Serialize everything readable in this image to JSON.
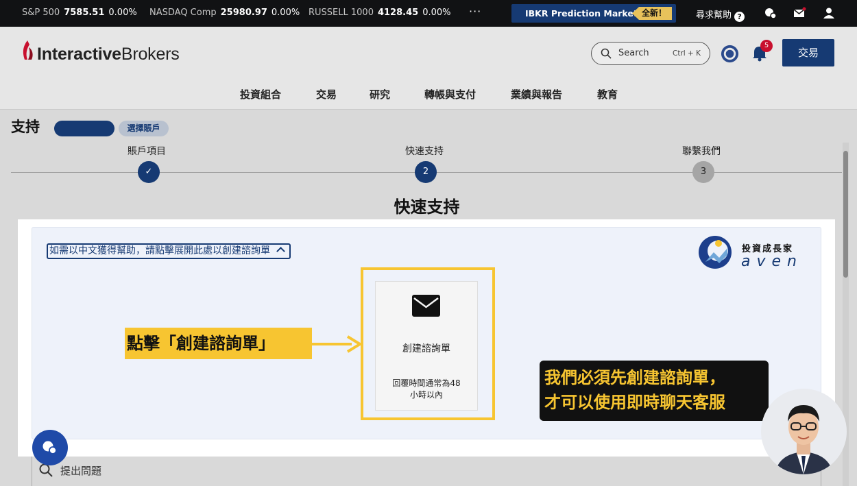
{
  "ticker": {
    "items": [
      {
        "name": "S&P 500",
        "value": "7585.51",
        "change": "0.00%"
      },
      {
        "name": "NASDAQ Comp",
        "value": "25980.97",
        "change": "0.00%"
      },
      {
        "name": "RUSSELL 1000",
        "value": "4128.45",
        "change": "0.00%"
      }
    ],
    "more": "···",
    "promo": {
      "label": "IBKR Prediction Markets",
      "badge": "全新！"
    },
    "help_label": "尋求幫助",
    "help_q": "?"
  },
  "header": {
    "logo_bold": "Interactive",
    "logo_rest": "Brokers",
    "search": {
      "placeholder": "Search",
      "shortcut": "Ctrl + K"
    },
    "notification_count": "5",
    "trade_button": "交易",
    "nav": [
      "投資組合",
      "交易",
      "研究",
      "轉帳與支付",
      "業績與報告",
      "教育"
    ]
  },
  "support": {
    "title": "支持",
    "select_account": "選擇賬戶",
    "steps": [
      {
        "label": "賬戶項目",
        "marker": "✓",
        "state": "done"
      },
      {
        "label": "快速支持",
        "marker": "2",
        "state": "current"
      },
      {
        "label": "聯繫我們",
        "marker": "3",
        "state": "todo"
      }
    ],
    "section_title": "快速支持",
    "chinese_help_link": "如需以中文獲得幫助，請點擊展開此處以創建諮詢單",
    "card": {
      "title": "創建諮詢單",
      "subtitle_line1": "回覆時間通常為48",
      "subtitle_line2": "小時以內"
    },
    "ask_question": "提出問題"
  },
  "annotations": {
    "callout": "點擊「創建諮詢單」",
    "note_line1": "我們必須先創建諮詢單，",
    "note_line2": "才可以使用即時聊天客服",
    "brand_zh": "投資成長家",
    "brand_en": "aven"
  },
  "colors": {
    "ibkr_navy": "#163a73",
    "highlight_yellow": "#f7c531",
    "alert_red": "#c8102e"
  },
  "icons": [
    "search-icon",
    "notification-bell-icon",
    "mail-icon",
    "chat-icon",
    "user-icon",
    "help-icon",
    "checkmark-icon",
    "chevron-up-icon",
    "arrow-right-icon"
  ]
}
